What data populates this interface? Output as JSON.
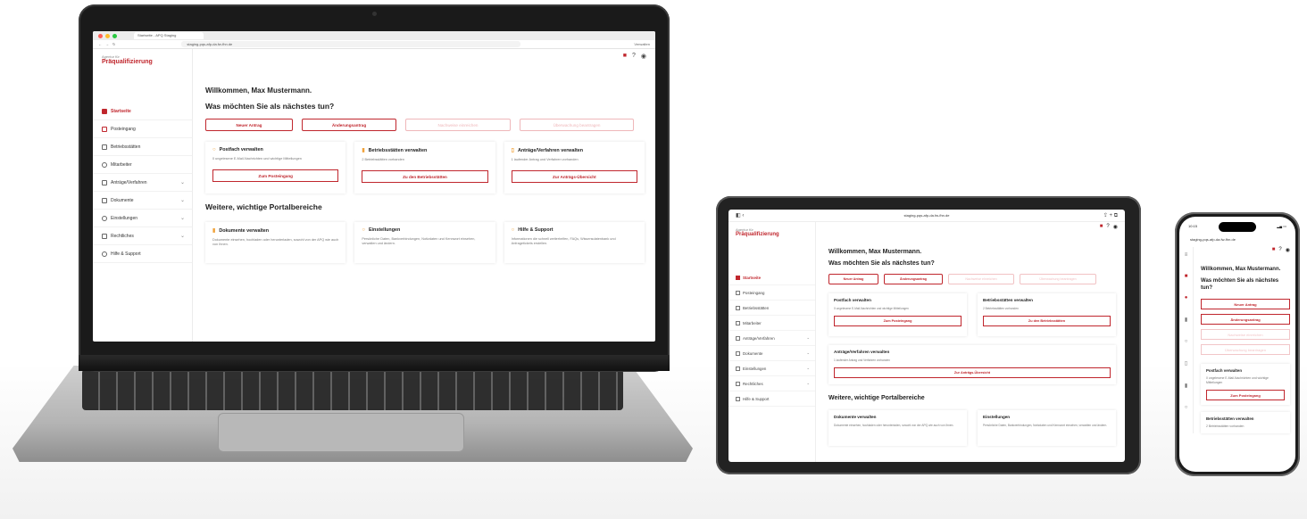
{
  "browser": {
    "tab_title": "Startseite - APQ Staging",
    "url": "staging-pqs-afp-da.fw-fhn.de",
    "tablet_url": "staging-pqs-afp-da.fw-fhn.de",
    "phone_url": "staging-pqs-afp-da.fw-fhn.de",
    "user_label": "Verwalten"
  },
  "logo": {
    "small": "Agentur für",
    "big": "Präqualifizierung"
  },
  "nav": [
    {
      "label": "Startseite",
      "active": true,
      "chevron": false
    },
    {
      "label": "Posteingang",
      "chevron": false
    },
    {
      "label": "Betriebsstätten",
      "chevron": false
    },
    {
      "label": "Mitarbeiter",
      "chevron": false
    },
    {
      "label": "Anträge/Verfahren",
      "chevron": true
    },
    {
      "label": "Dokumente",
      "chevron": true
    },
    {
      "label": "Einstellungen",
      "chevron": true
    },
    {
      "label": "Rechtliches",
      "chevron": true
    },
    {
      "label": "Hilfe & Support",
      "chevron": false
    }
  ],
  "main": {
    "greeting": "Willkommen, Max Mustermann.",
    "question": "Was möchten Sie als nächstes tun?",
    "actions": [
      "Neuer Antrag",
      "Änderungsantrag",
      "Nachweise einreichen",
      "Überwachung beantragen"
    ],
    "cards": [
      {
        "title": "Postfach verwalten",
        "text": "0 ungelesene E-Mail-Nachrichten und wichtige Mitteilungen",
        "button": "Zum Posteingang"
      },
      {
        "title": "Betriebsstätten verwalten",
        "text": "2 Betriebsstätten vorhanden",
        "button": "Zu den Betriebsstätten"
      },
      {
        "title": "Anträge/Verfahren verwalten",
        "text": "1 laufender Antrag und Verfahren vorhanden",
        "button": "Zur Anträgs-Übersicht"
      }
    ],
    "section2_title": "Weitere, wichtige Portalbereiche",
    "cards2": [
      {
        "title": "Dokumente verwalten",
        "text": "Dokumente einsehen, hochladen oder herunterladen, sowohl von der APQ wie auch von Ihnen."
      },
      {
        "title": "Einstellungen",
        "text": "Persönliche Daten, Bankverbindungen, Notizdaten und Kennwort einsehen, verwalten und ändern."
      },
      {
        "title": "Hilfe & Support",
        "text": "Informationen die schnell weiterhelfen, FAQs, Wissensdatenbank und Anfragetickets erstellen."
      }
    ]
  },
  "phone": {
    "time": "10:15"
  },
  "colors": {
    "accent": "#c0262d",
    "accent_light": "#efb7ba",
    "card_icon": "#f0a23a"
  }
}
